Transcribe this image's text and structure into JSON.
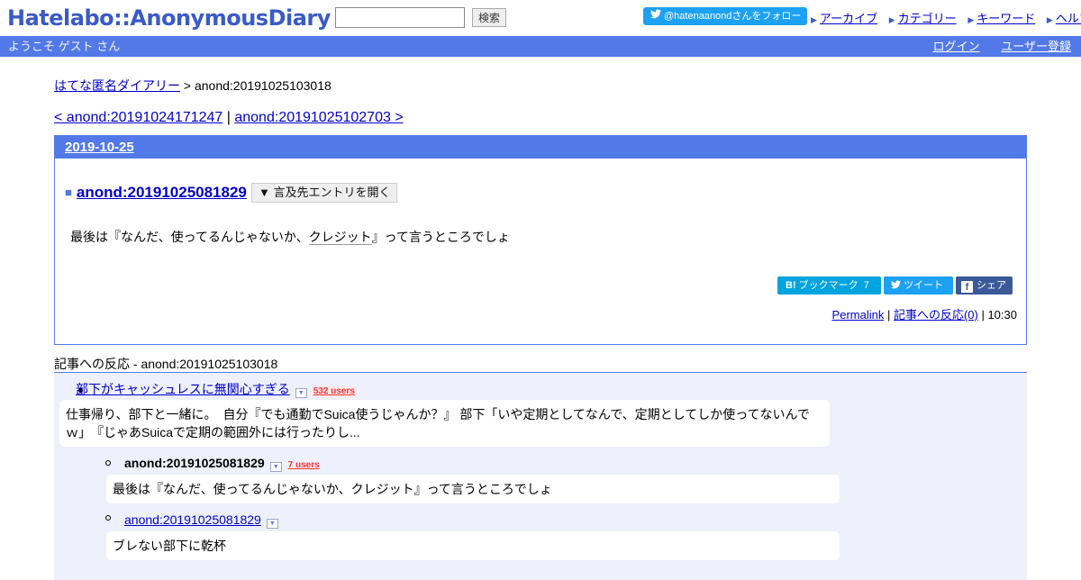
{
  "header": {
    "logo": "Hatelabo::AnonymousDiary",
    "search_button": "検索",
    "search_value": "",
    "twitter_follow": "@hatenaanondさんをフォロー",
    "links": [
      "アーカイブ",
      "カテゴリー",
      "キーワード",
      "ヘルプ"
    ]
  },
  "welcome_bar": {
    "text": "ようこそ ゲスト さん",
    "login": "ログイン",
    "register": "ユーザー登録"
  },
  "breadcrumb": {
    "home": "はてな匿名ダイアリー",
    "separator": " > ",
    "current": "anond:20191025103018"
  },
  "prevnext": {
    "prev": "< anond:20191024171247",
    "separator": " | ",
    "next": "anond:20191025102703 >"
  },
  "day": {
    "date": "2019-10-25",
    "entry": {
      "title": "anond:20191025081829",
      "open_ref_button": "▼ 言及先エントリを開く",
      "body_before": "最後は『なんだ、使ってるんじゃないか、",
      "body_keyword": "クレジット",
      "body_after": "』って言うところでしょ",
      "bookmark_label": "ブックマーク",
      "bookmark_count": "7",
      "tweet_label": "ツイート",
      "share_label": "シェア",
      "permalink": "Permalink",
      "meta_sep": " | ",
      "reactions_link": "記事への反応(0)",
      "time": "10:30"
    }
  },
  "reactions": {
    "title": "記事への反応 - anond:20191025103018",
    "items": [
      {
        "title": "部下がキャッシュレスに無関心すぎる",
        "users": "532 users",
        "body": "仕事帰り、部下と一緒に。　自分『でも通勤でSuica使うじゃんか？』 部下「いや定期としてなんで、定期としてしか使ってないんでｗ」　『じゃあSuicaで定期の範囲外には行ったりし..."
      },
      {
        "title": "anond:20191025081829",
        "users": "7 users",
        "body": "最後は『なんだ、使ってるんじゃないか、クレジット』って言うところでしょ"
      },
      {
        "title": "anond:20191025081829",
        "body": "ブレない部下に乾杯"
      }
    ]
  },
  "colors": {
    "brand_blue": "#5279e7",
    "link": "#0000cc",
    "twitter": "#1da1f2",
    "hatena_bookmark": "#00a4de",
    "facebook": "#3b5998",
    "users_red": "#ff3333",
    "reaction_bg": "#eef1fb"
  }
}
